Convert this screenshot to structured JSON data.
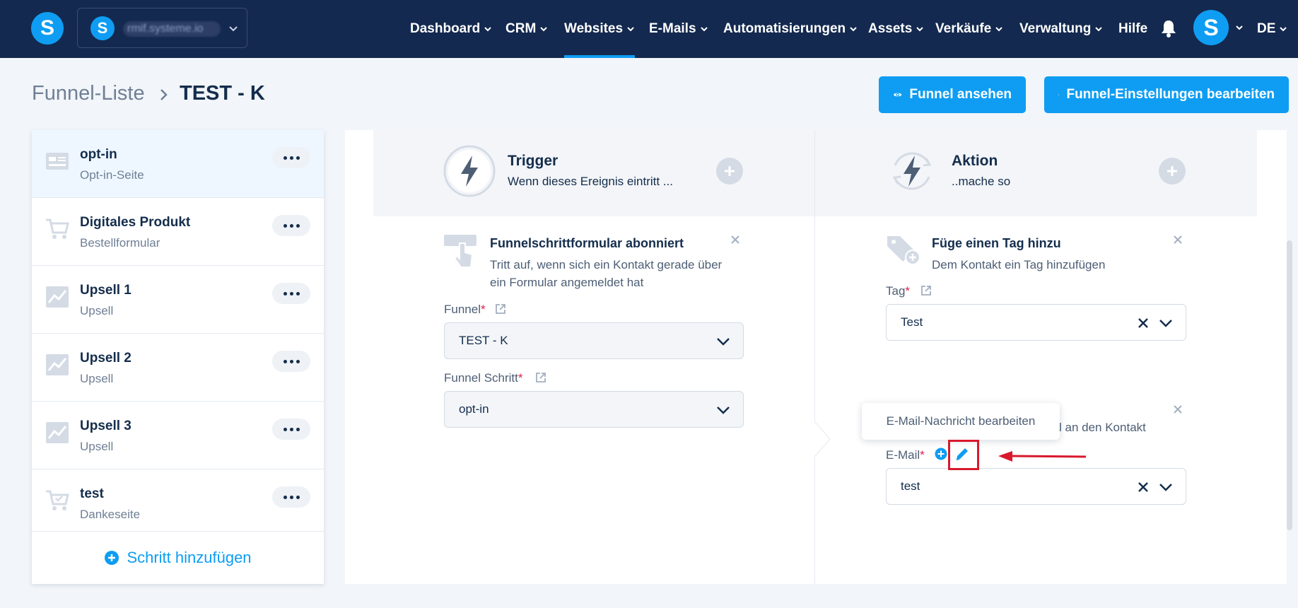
{
  "brand": {
    "logo_letter": "S",
    "account_name": "rmif.systeme.io"
  },
  "nav": {
    "items": [
      {
        "label": "Dashboard",
        "dropdown": true
      },
      {
        "label": "CRM",
        "dropdown": true
      },
      {
        "label": "Websites",
        "dropdown": true,
        "active": true
      },
      {
        "label": "E-Mails",
        "dropdown": true
      },
      {
        "label": "Automatisierungen",
        "dropdown": true
      },
      {
        "label": "Assets",
        "dropdown": true
      },
      {
        "label": "Verkäufe",
        "dropdown": true
      },
      {
        "label": "Verwaltung",
        "dropdown": true
      },
      {
        "label": "Hilfe",
        "dropdown": false
      }
    ],
    "avatar_letter": "S",
    "language": "DE"
  },
  "breadcrumb": {
    "root": "Funnel-Liste",
    "current": "TEST - K"
  },
  "header_buttons": {
    "view_funnel": "Funnel ansehen",
    "edit_settings": "Funnel-Einstellungen bearbeiten"
  },
  "steps": [
    {
      "title": "opt-in",
      "subtitle": "Opt-in-Seite",
      "icon": "optin-page-icon",
      "active": true
    },
    {
      "title": "Digitales Produkt",
      "subtitle": "Bestellformular",
      "icon": "cart-icon"
    },
    {
      "title": "Upsell 1",
      "subtitle": "Upsell",
      "icon": "chart-up-icon"
    },
    {
      "title": "Upsell 2",
      "subtitle": "Upsell",
      "icon": "chart-up-icon"
    },
    {
      "title": "Upsell 3",
      "subtitle": "Upsell",
      "icon": "chart-up-icon"
    },
    {
      "title": "test",
      "subtitle": "Dankeseite",
      "icon": "cart-check-icon"
    }
  ],
  "add_step_label": "Schritt hinzufügen",
  "trigger": {
    "title": "Trigger",
    "subtitle": "Wenn dieses Ereignis eintritt ...",
    "card": {
      "title": "Funnelschrittformular abonniert",
      "description": "Tritt auf, wenn sich ein Kontakt gerade über ein Formular angemeldet hat",
      "funnel_label": "Funnel",
      "funnel_value": "TEST - K",
      "step_label": "Funnel Schritt",
      "step_value": "opt-in"
    }
  },
  "action": {
    "title": "Aktion",
    "subtitle": "..mache so",
    "tag_card": {
      "title": "Füge einen Tag hinzu",
      "description": "Dem Kontakt ein Tag hinzufügen",
      "tag_label": "Tag",
      "tag_value": "Test"
    },
    "email_card": {
      "description_partial": "l an den Kontakt",
      "email_label": "E-Mail",
      "email_value": "test"
    }
  },
  "tooltip": "E-Mail-Nachricht bearbeiten",
  "colors": {
    "nav_bg": "#14294f",
    "accent": "#0e9df2",
    "highlight": "#d8192c"
  }
}
